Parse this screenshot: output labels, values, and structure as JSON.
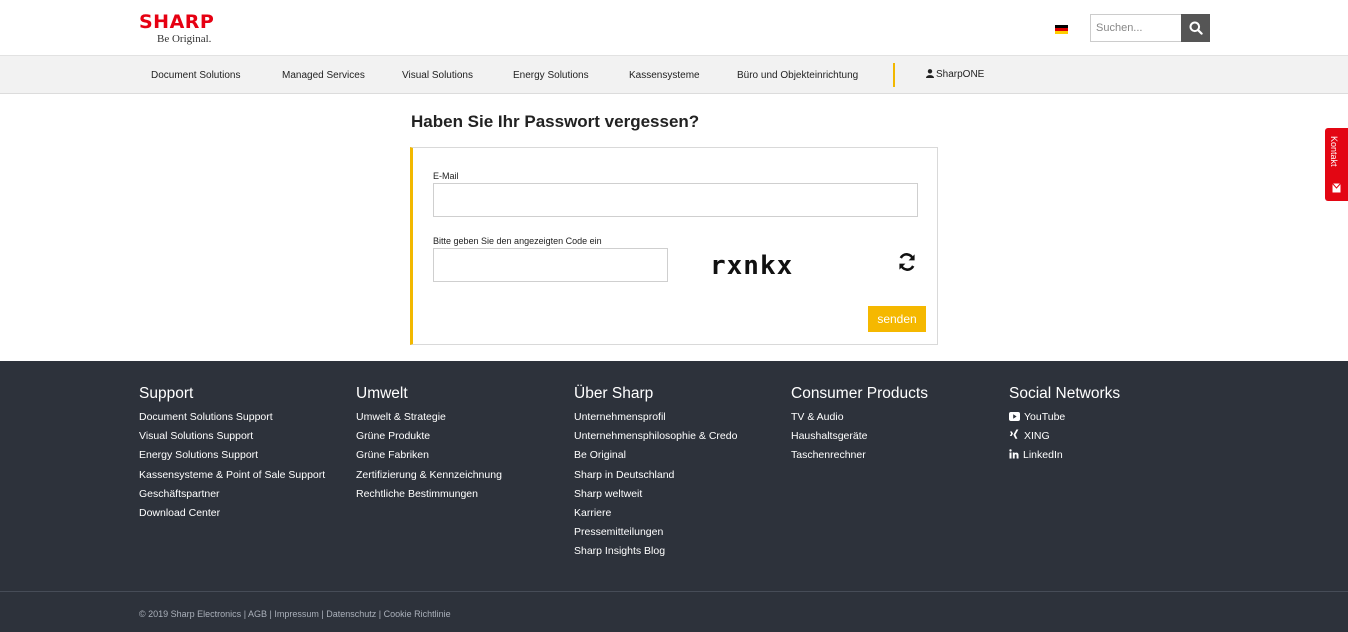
{
  "header": {
    "brand": "SHARP",
    "tagline": "Be Original.",
    "search_placeholder": "Suchen..."
  },
  "nav": {
    "items": [
      "Document Solutions",
      "Managed Services",
      "Visual Solutions",
      "Energy Solutions",
      "Kassensysteme",
      "Büro und Objekteinrichtung"
    ],
    "account": "SharpONE"
  },
  "contact_tab": "Kontakt",
  "form": {
    "title": "Haben Sie Ihr Passwort vergessen?",
    "email_label": "E-Mail",
    "email_value": "",
    "code_label": "Bitte geben Sie den angezeigten Code ein",
    "code_value": "",
    "captcha_text": "rxnkx",
    "submit_label": "senden"
  },
  "footer": {
    "columns": [
      {
        "heading": "Support",
        "links": [
          "Document Solutions Support",
          "Visual Solutions Support",
          "Energy Solutions Support",
          "Kassensysteme & Point of Sale Support",
          "Geschäftspartner",
          "Download Center"
        ]
      },
      {
        "heading": "Umwelt",
        "links": [
          "Umwelt & Strategie",
          "Grüne Produkte",
          "Grüne Fabriken",
          "Zertifizierung & Kennzeichnung",
          "Rechtliche Bestimmungen"
        ]
      },
      {
        "heading": "Über Sharp",
        "links": [
          "Unternehmensprofil",
          "Unternehmensphilosophie & Credo",
          "Be Original",
          "Sharp in Deutschland",
          "Sharp weltweit",
          "Karriere",
          "Pressemitteilungen",
          "Sharp Insights Blog"
        ]
      },
      {
        "heading": "Consumer Products",
        "links": [
          "TV & Audio",
          "Haushaltsgeräte",
          "Taschenrechner"
        ]
      },
      {
        "heading": "Social Networks",
        "links": [
          "YouTube",
          "XING",
          "LinkedIn"
        ]
      }
    ],
    "copyright": "© 2019 Sharp Electronics",
    "legal_links": [
      "AGB",
      "Impressum",
      "Datenschutz",
      "Cookie Richtlinie"
    ]
  },
  "colors": {
    "brand_red": "#e60012",
    "accent_yellow": "#f5b800",
    "footer_bg": "#2d323b"
  },
  "icons": {
    "search": "search-icon",
    "flag": "german-flag-icon",
    "user": "user-icon",
    "refresh": "refresh-icon",
    "mail": "mail-icon",
    "youtube": "youtube-icon",
    "xing": "xing-icon",
    "linkedin": "linkedin-icon"
  }
}
